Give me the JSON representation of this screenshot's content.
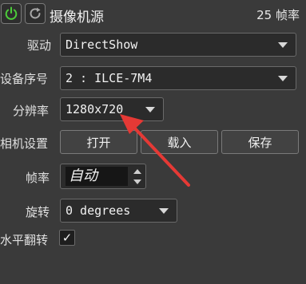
{
  "header": {
    "title": "摄像机源",
    "fps_status": "25 帧率",
    "power_icon_color": "#4ccd3a"
  },
  "form": {
    "driver": {
      "label": "驱动",
      "value": "DirectShow"
    },
    "device": {
      "label": "设备序号",
      "value": "2 : ILCE-7M4"
    },
    "resolution": {
      "label": "分辨率",
      "value": "1280x720"
    },
    "camera_settings": {
      "label": "相机设置",
      "open_label": "打开",
      "load_label": "载入",
      "save_label": "保存"
    },
    "framerate": {
      "label": "帧率",
      "value": "自动"
    },
    "rotation": {
      "label": "旋转",
      "value": "0 degrees"
    },
    "mirror": {
      "label": "水平翻转",
      "checked": true,
      "check_glyph": "✓"
    }
  },
  "annotation_color": "#e53935"
}
